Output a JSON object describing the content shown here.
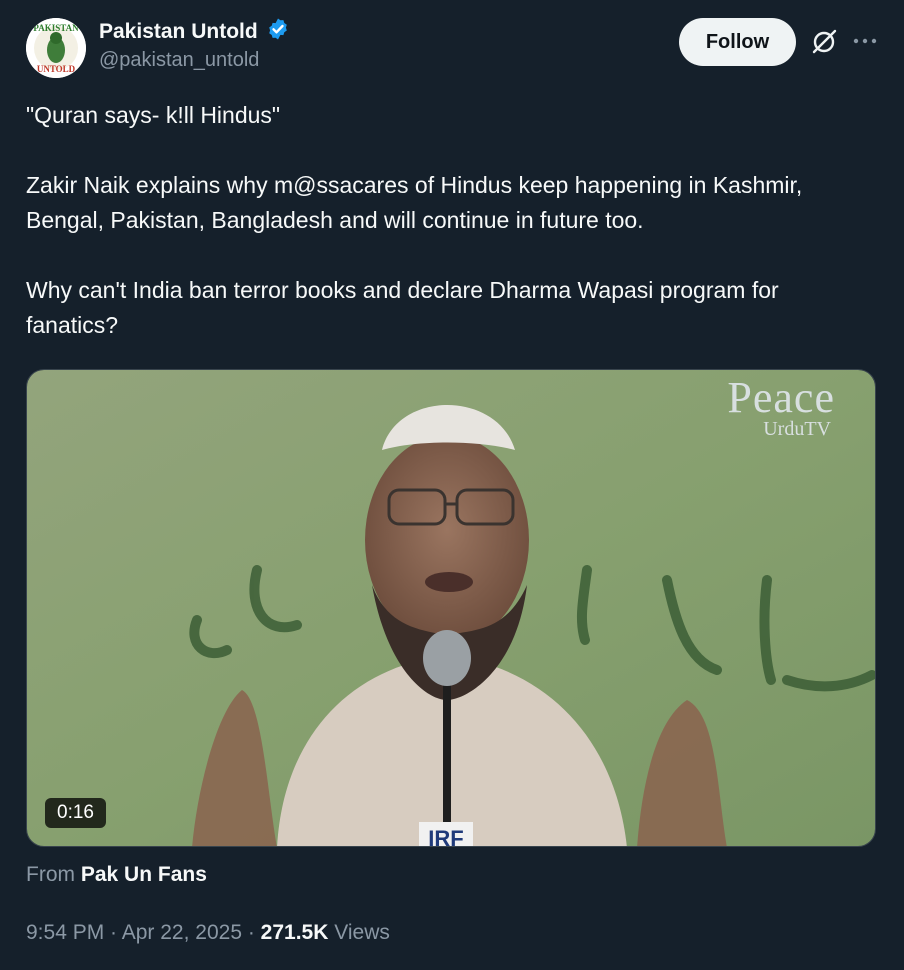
{
  "author": {
    "display_name": "Pakistan Untold",
    "handle": "@pakistan_untold",
    "avatar_text_top": "PAKISTAN",
    "avatar_text_bottom": "UNTOLD",
    "verified": true
  },
  "header": {
    "follow_label": "Follow",
    "grok_icon": "grok-icon",
    "more_icon": "more-options-icon"
  },
  "tweet": {
    "line1": "\"Quran says- k!ll Hindus\"",
    "para2": "Zakir Naik explains why m@ssacares of Hindus keep happening in Kashmir, Bengal, Pakistan, Bangladesh and will continue in future too.",
    "para3": "Why can't India ban terror books and declare Dharma Wapasi program for fanatics?"
  },
  "media": {
    "duration": "0:16",
    "watermark_main": "Peace",
    "watermark_sub": "UrduTV",
    "mic_label": "IRF"
  },
  "attribution": {
    "prefix": "From",
    "source": "Pak Un Fans"
  },
  "meta": {
    "time": "9:54 PM",
    "sep1": " · ",
    "date": "Apr 22, 2025",
    "sep2": " · ",
    "views_count": "271.5K",
    "views_label": " Views"
  },
  "colors": {
    "background": "#15202b",
    "verified": "#1d9bf0",
    "secondary_text": "#8b98a5",
    "follow_bg": "#eff3f4"
  }
}
